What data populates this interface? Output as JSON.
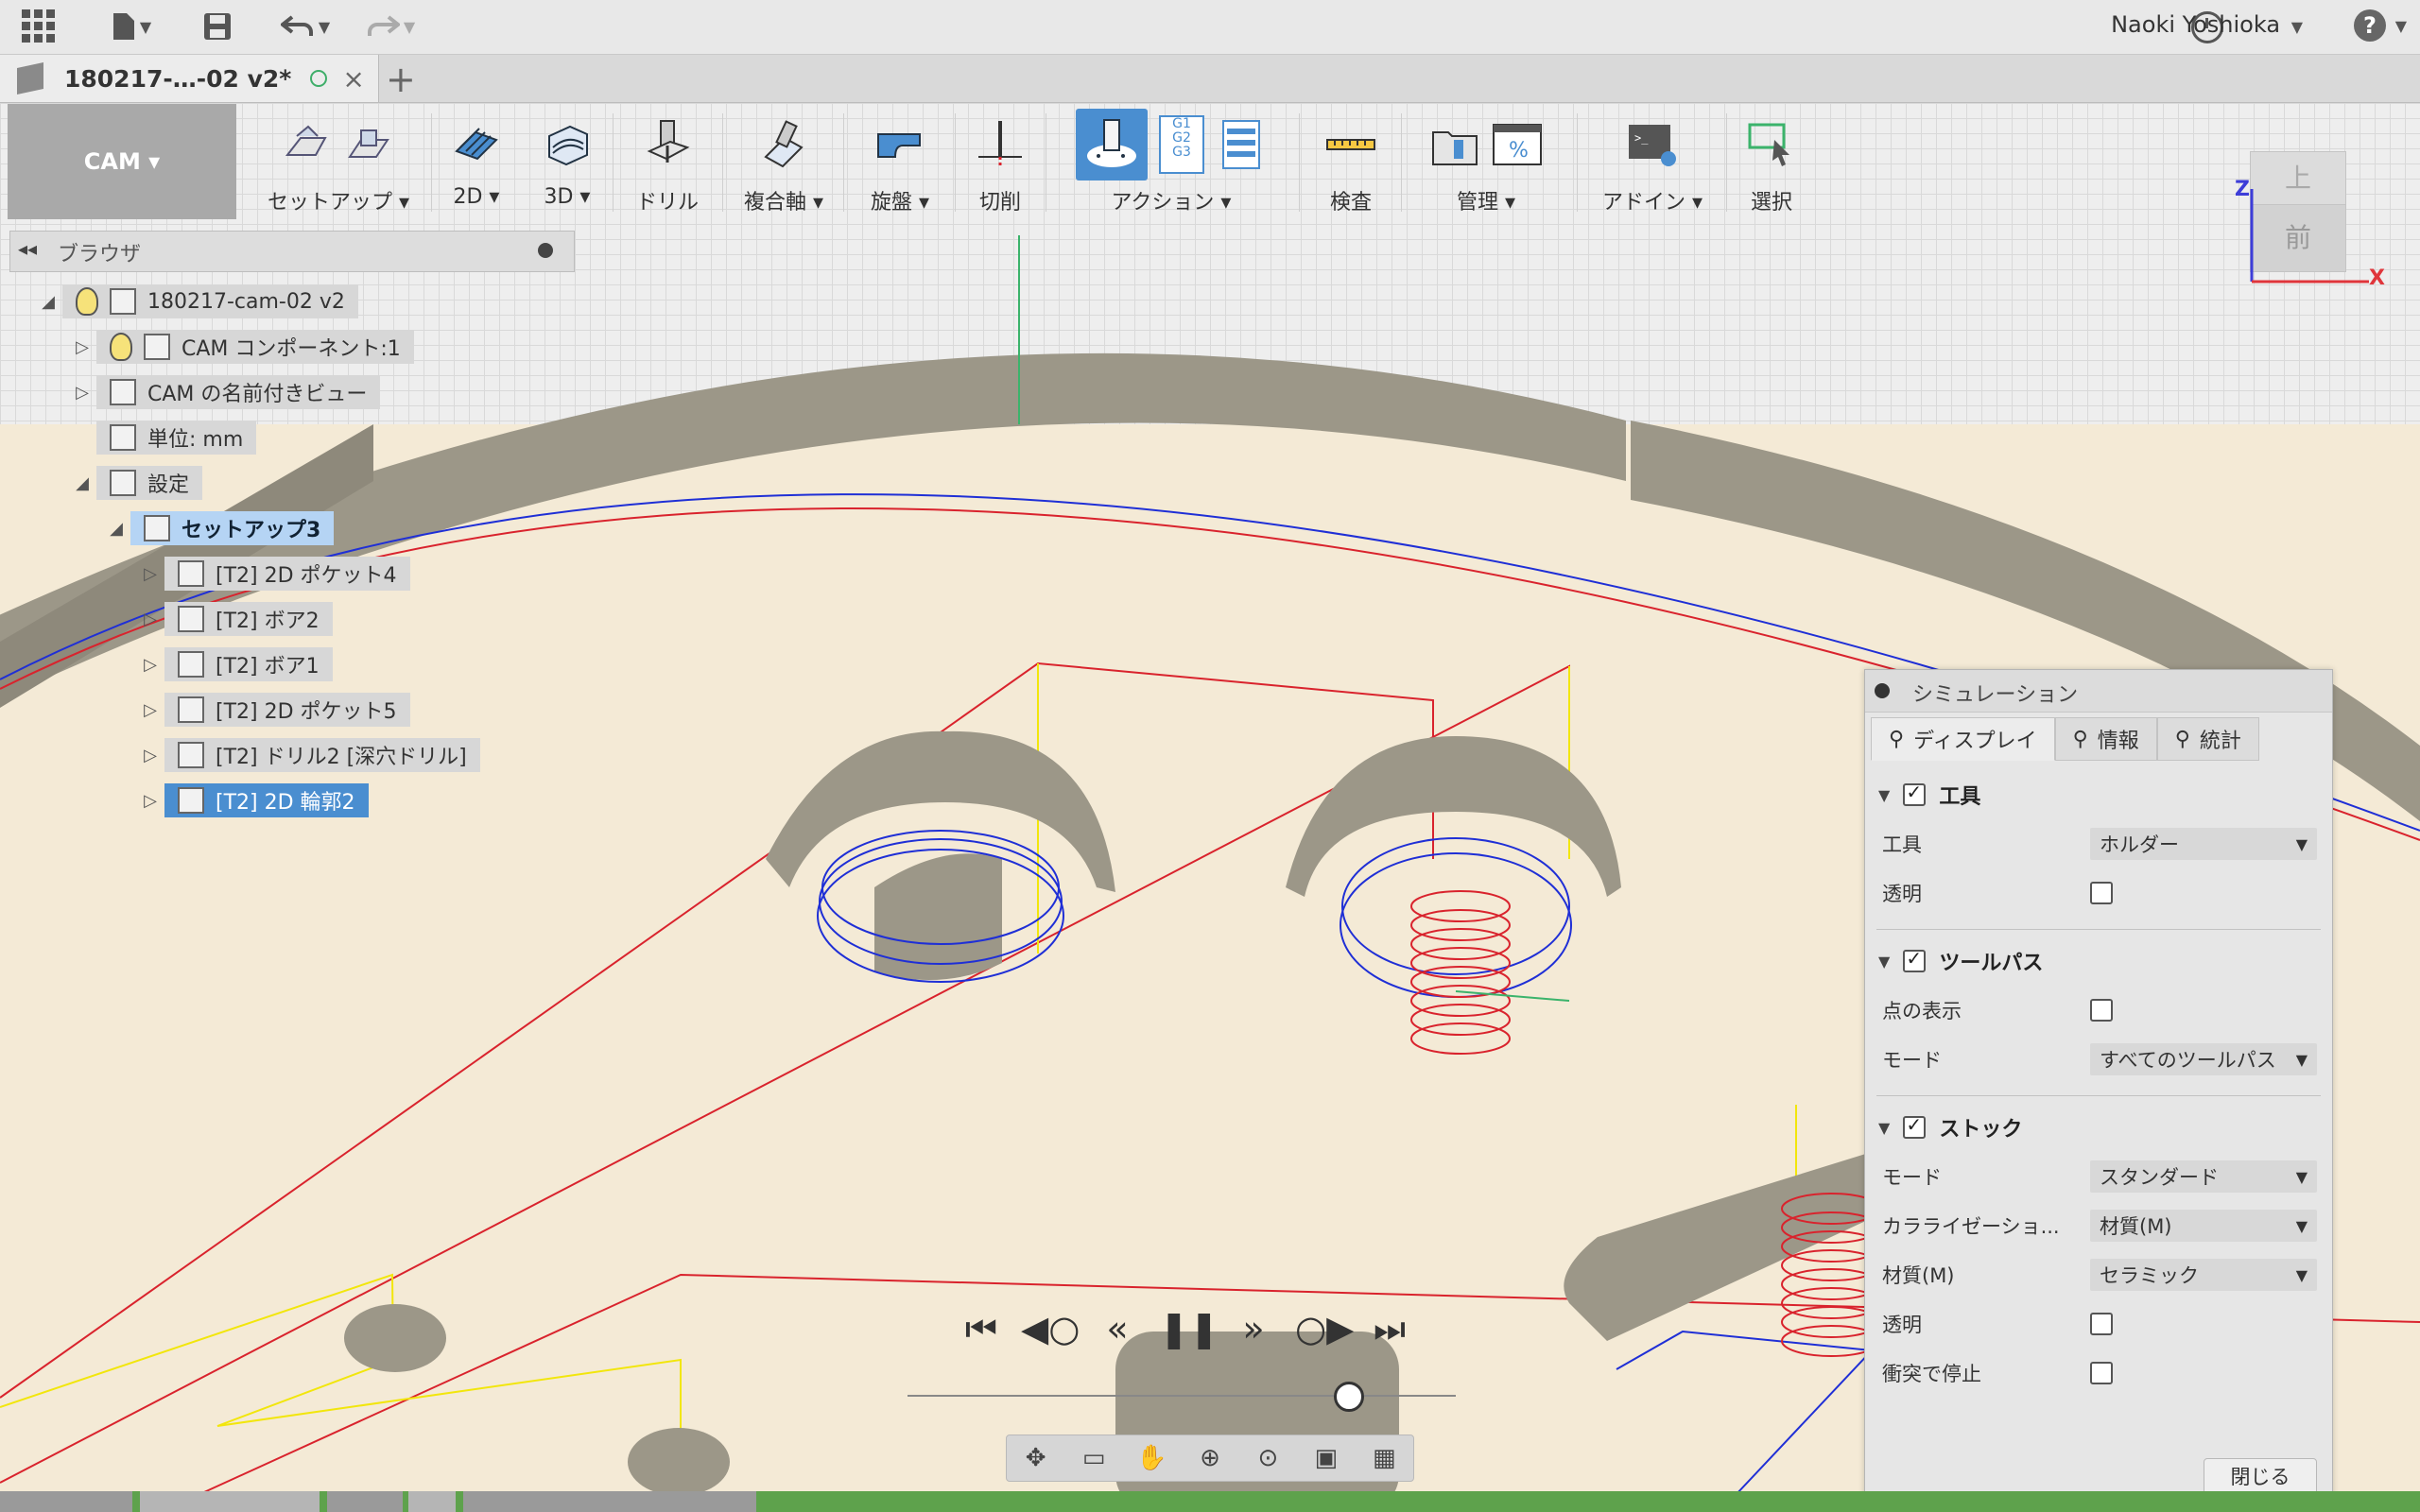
{
  "user": {
    "name": "Naoki Yoshioka"
  },
  "help": {
    "label": "?"
  },
  "document_tab": {
    "title": "180217-…-02 v2*",
    "close": "×"
  },
  "new_tab": "+",
  "toolbar": {
    "workspace": "CAM ▾",
    "groups": [
      {
        "label": "セットアップ ▾"
      },
      {
        "label": "2D ▾"
      },
      {
        "label": "3D ▾"
      },
      {
        "label": "ドリル"
      },
      {
        "label": "複合軸 ▾"
      },
      {
        "label": "旋盤 ▾"
      },
      {
        "label": "切削"
      },
      {
        "label": "アクション ▾"
      },
      {
        "label": "検査"
      },
      {
        "label": "管理 ▾"
      },
      {
        "label": "アドイン ▾"
      },
      {
        "label": "選択"
      }
    ],
    "gcode_icon_text": "G1\nG2\nG3",
    "percent_icon_text": "%"
  },
  "browser": {
    "title": "ブラウザ",
    "nodes": [
      {
        "label": "180217-cam-02 v2"
      },
      {
        "label": "CAM コンポーネント:1"
      },
      {
        "label": "CAM の名前付きビュー"
      },
      {
        "label": "単位: mm"
      },
      {
        "label": "設定"
      },
      {
        "label": "セットアップ3"
      },
      {
        "label": "[T2] 2D ポケット4"
      },
      {
        "label": "[T2] ボア2"
      },
      {
        "label": "[T2] ボア1"
      },
      {
        "label": "[T2] 2D ポケット5"
      },
      {
        "label": "[T2] ドリル2 [深穴ドリル]"
      },
      {
        "label": "[T2] 2D 輪郭2"
      }
    ]
  },
  "viewcube": {
    "top": "上",
    "front": "前",
    "z": "Z",
    "x": "X"
  },
  "simulation": {
    "title": "シミュレーション",
    "tabs": [
      {
        "label": "ディスプレイ"
      },
      {
        "label": "情報"
      },
      {
        "label": "統計"
      }
    ],
    "sections": {
      "tool": {
        "title": "工具",
        "enabled": true,
        "rows": [
          {
            "label": "工具",
            "value": "ホルダー"
          },
          {
            "label": "透明",
            "checked": false
          }
        ]
      },
      "toolpath": {
        "title": "ツールパス",
        "enabled": true,
        "rows": [
          {
            "label": "点の表示",
            "checked": false
          },
          {
            "label": "モード",
            "value": "すべてのツールパス"
          }
        ]
      },
      "stock": {
        "title": "ストック",
        "enabled": true,
        "rows": [
          {
            "label": "モード",
            "value": "スタンダード"
          },
          {
            "label": "カラライゼーショ...",
            "value": "材質(M)"
          },
          {
            "label": "材質(M)",
            "value": "セラミック"
          },
          {
            "label": "透明",
            "checked": false
          },
          {
            "label": "衝突で停止",
            "checked": false
          }
        ]
      }
    },
    "close_label": "閉じる"
  },
  "playback": {
    "paused": true,
    "progress": 0.8
  },
  "colors": {
    "accent_blue": "#4a8ed0",
    "toolpath_red": "#d9232d",
    "toolpath_blue": "#1f2fd6",
    "toolpath_yellow": "#f2e60c",
    "stock": "#9c9788",
    "viewport_bg": "#f4ead6"
  }
}
